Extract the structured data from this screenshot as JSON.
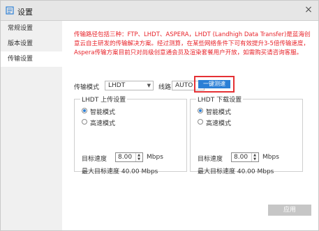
{
  "window": {
    "title": "设置",
    "close": "×"
  },
  "sidebar": {
    "items": [
      {
        "label": "常规设置"
      },
      {
        "label": "版本设置"
      },
      {
        "label": "传输设置"
      }
    ]
  },
  "notice": "传输路径包括三种：FTP、LHDT、ASPERA，LHDT (Landhigh Data Transfer)是蓝海创意云自主研发的传输解决方案。经过测算，在某些网络条件下可有效提升3-5倍传输速度，Aspera传输方案目前只对尚级创意通会员及渲染套餐用户开放，如需购买请咨询客服。",
  "transfer": {
    "mode_label": "传输模式",
    "mode_value": "LHDT",
    "line_label": "线路",
    "line_value": "AUTO",
    "test_button": "一键测速"
  },
  "upload": {
    "title": "LHDT 上传设置",
    "smart": "智能模式",
    "fast": "高速模式",
    "target_label": "目标速度",
    "target_value": "8.00",
    "unit": "Mbps",
    "max_label": "最大目标速度 40.00 Mbps"
  },
  "download": {
    "title": "LHDT 下载设置",
    "smart": "智能模式",
    "fast": "高速模式",
    "target_label": "目标速度",
    "target_value": "8.00",
    "unit": "Mbps",
    "max_label": "最大目标速度 40.00 Mbps"
  },
  "apply_button": "应用",
  "colors": {
    "accent": "#2b7fd6",
    "notice": "#e8242b",
    "highlight": "#e53034"
  }
}
